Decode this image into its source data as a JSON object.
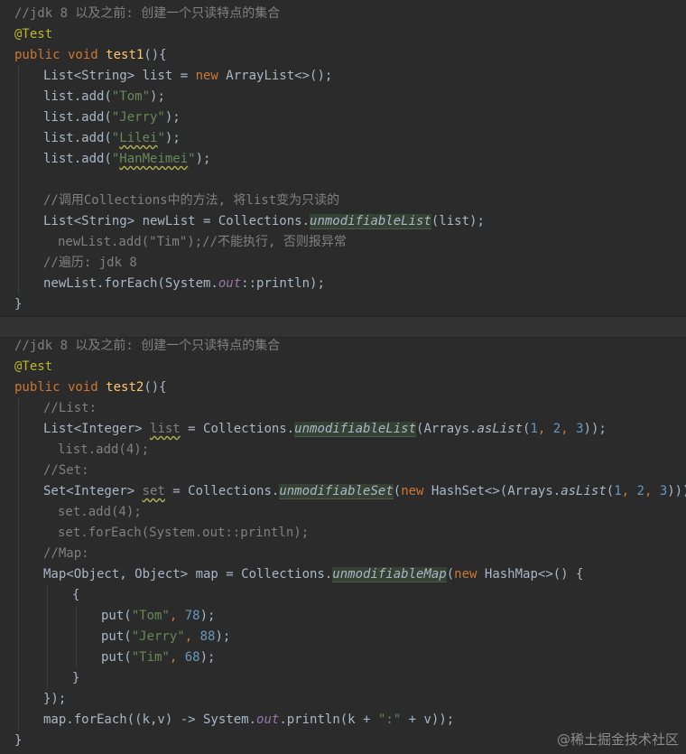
{
  "code_blocks": [
    {
      "lines": [
        {
          "indent": 0,
          "tokens": [
            {
              "t": "//jdk 8 以及之前: 创建一个只读特点的集合",
              "c": "comment"
            }
          ]
        },
        {
          "indent": 0,
          "tokens": [
            {
              "t": "@Test",
              "c": "annotation"
            }
          ]
        },
        {
          "indent": 0,
          "tokens": [
            {
              "t": "public void ",
              "c": "kw"
            },
            {
              "t": "test1",
              "c": "fn"
            },
            {
              "t": "(){",
              "c": "plain"
            }
          ]
        },
        {
          "indent": 4,
          "tokens": [
            {
              "t": "List<String> list = ",
              "c": "plain"
            },
            {
              "t": "new ",
              "c": "kw"
            },
            {
              "t": "ArrayList<>();",
              "c": "plain"
            }
          ]
        },
        {
          "indent": 4,
          "tokens": [
            {
              "t": "list.add(",
              "c": "plain"
            },
            {
              "t": "\"Tom\"",
              "c": "str"
            },
            {
              "t": ");",
              "c": "plain"
            }
          ]
        },
        {
          "indent": 4,
          "tokens": [
            {
              "t": "list.add(",
              "c": "plain"
            },
            {
              "t": "\"Jerry\"",
              "c": "str"
            },
            {
              "t": ");",
              "c": "plain"
            }
          ]
        },
        {
          "indent": 4,
          "tokens": [
            {
              "t": "list.add(",
              "c": "plain"
            },
            {
              "t": "\"",
              "c": "str"
            },
            {
              "t": "Lilei",
              "c": "str squiggle"
            },
            {
              "t": "\"",
              "c": "str"
            },
            {
              "t": ");",
              "c": "plain"
            }
          ]
        },
        {
          "indent": 4,
          "tokens": [
            {
              "t": "list.add(",
              "c": "plain"
            },
            {
              "t": "\"",
              "c": "str"
            },
            {
              "t": "HanMeimei",
              "c": "str squiggle"
            },
            {
              "t": "\"",
              "c": "str"
            },
            {
              "t": ");",
              "c": "plain"
            }
          ]
        },
        {
          "indent": 0,
          "tokens": []
        },
        {
          "indent": 4,
          "tokens": [
            {
              "t": "//调用Collections中的方法, 将list变为只读的",
              "c": "comment"
            }
          ]
        },
        {
          "indent": 4,
          "tokens": [
            {
              "t": "List<String> newList = Collections.",
              "c": "plain"
            },
            {
              "t": "unmodifiableList",
              "c": "hl"
            },
            {
              "t": "(list);",
              "c": "plain"
            }
          ]
        },
        {
          "indent": 6,
          "tokens": [
            {
              "t": "newList.add(\"Tim\");//不能执行, 否则报异常",
              "c": "comment"
            }
          ]
        },
        {
          "indent": 4,
          "tokens": [
            {
              "t": "//遍历: jdk 8",
              "c": "comment"
            }
          ]
        },
        {
          "indent": 4,
          "tokens": [
            {
              "t": "newList.forEach(System.",
              "c": "plain"
            },
            {
              "t": "out",
              "c": "field"
            },
            {
              "t": "::println);",
              "c": "plain"
            }
          ]
        },
        {
          "indent": 0,
          "tokens": [
            {
              "t": "}",
              "c": "plain"
            }
          ]
        }
      ]
    },
    {
      "lines": [
        {
          "indent": 0,
          "tokens": [
            {
              "t": "//jdk 8 以及之前: 创建一个只读特点的集合",
              "c": "comment"
            }
          ]
        },
        {
          "indent": 0,
          "tokens": [
            {
              "t": "@Test",
              "c": "annotation"
            }
          ]
        },
        {
          "indent": 0,
          "tokens": [
            {
              "t": "public void ",
              "c": "kw"
            },
            {
              "t": "test2",
              "c": "fn"
            },
            {
              "t": "(){",
              "c": "plain"
            }
          ]
        },
        {
          "indent": 4,
          "tokens": [
            {
              "t": "//List:",
              "c": "comment"
            }
          ]
        },
        {
          "indent": 4,
          "tokens": [
            {
              "t": "List<Integer> ",
              "c": "plain"
            },
            {
              "t": "list",
              "c": "comment squiggle"
            },
            {
              "t": " = Collections.",
              "c": "plain"
            },
            {
              "t": "unmodifiableList",
              "c": "hl"
            },
            {
              "t": "(Arrays.",
              "c": "plain"
            },
            {
              "t": "asList",
              "c": "static"
            },
            {
              "t": "(",
              "c": "plain"
            },
            {
              "t": "1",
              "c": "num"
            },
            {
              "t": ", ",
              "c": "kw"
            },
            {
              "t": "2",
              "c": "num"
            },
            {
              "t": ", ",
              "c": "kw"
            },
            {
              "t": "3",
              "c": "num"
            },
            {
              "t": "));",
              "c": "plain"
            }
          ]
        },
        {
          "indent": 6,
          "tokens": [
            {
              "t": "list.add(4);",
              "c": "comment"
            }
          ]
        },
        {
          "indent": 4,
          "tokens": [
            {
              "t": "//Set:",
              "c": "comment"
            }
          ]
        },
        {
          "indent": 4,
          "tokens": [
            {
              "t": "Set<Integer> ",
              "c": "plain"
            },
            {
              "t": "set",
              "c": "comment squiggle"
            },
            {
              "t": " = Collections.",
              "c": "plain"
            },
            {
              "t": "unmodifiableSet",
              "c": "hl"
            },
            {
              "t": "(",
              "c": "plain"
            },
            {
              "t": "new ",
              "c": "kw"
            },
            {
              "t": "HashSet<>(Arrays.",
              "c": "plain"
            },
            {
              "t": "asList",
              "c": "static"
            },
            {
              "t": "(",
              "c": "plain"
            },
            {
              "t": "1",
              "c": "num"
            },
            {
              "t": ", ",
              "c": "kw"
            },
            {
              "t": "2",
              "c": "num"
            },
            {
              "t": ", ",
              "c": "kw"
            },
            {
              "t": "3",
              "c": "num"
            },
            {
              "t": ")));",
              "c": "plain"
            }
          ]
        },
        {
          "indent": 6,
          "tokens": [
            {
              "t": "set.add(4);",
              "c": "comment"
            }
          ]
        },
        {
          "indent": 6,
          "tokens": [
            {
              "t": "set.forEach(System.out::println);",
              "c": "comment"
            }
          ]
        },
        {
          "indent": 4,
          "tokens": [
            {
              "t": "//Map:",
              "c": "comment"
            }
          ]
        },
        {
          "indent": 4,
          "tokens": [
            {
              "t": "Map<Object, Object> map = Collections.",
              "c": "plain"
            },
            {
              "t": "unmodifiableMap",
              "c": "hl"
            },
            {
              "t": "(",
              "c": "plain"
            },
            {
              "t": "new ",
              "c": "kw"
            },
            {
              "t": "HashMap<>() {",
              "c": "plain"
            }
          ]
        },
        {
          "indent": 8,
          "tokens": [
            {
              "t": "{",
              "c": "plain"
            }
          ]
        },
        {
          "indent": 12,
          "tokens": [
            {
              "t": "put(",
              "c": "plain"
            },
            {
              "t": "\"Tom\"",
              "c": "str"
            },
            {
              "t": ", ",
              "c": "kw"
            },
            {
              "t": "78",
              "c": "num"
            },
            {
              "t": ");",
              "c": "plain"
            }
          ]
        },
        {
          "indent": 12,
          "tokens": [
            {
              "t": "put(",
              "c": "plain"
            },
            {
              "t": "\"Jerry\"",
              "c": "str"
            },
            {
              "t": ", ",
              "c": "kw"
            },
            {
              "t": "88",
              "c": "num"
            },
            {
              "t": ");",
              "c": "plain"
            }
          ]
        },
        {
          "indent": 12,
          "tokens": [
            {
              "t": "put(",
              "c": "plain"
            },
            {
              "t": "\"Tim\"",
              "c": "str"
            },
            {
              "t": ", ",
              "c": "kw"
            },
            {
              "t": "68",
              "c": "num"
            },
            {
              "t": ");",
              "c": "plain"
            }
          ]
        },
        {
          "indent": 8,
          "tokens": [
            {
              "t": "}",
              "c": "plain"
            }
          ]
        },
        {
          "indent": 4,
          "tokens": [
            {
              "t": "});",
              "c": "plain"
            }
          ]
        },
        {
          "indent": 4,
          "tokens": [
            {
              "t": "map.forEach((k,v) -> System.",
              "c": "plain"
            },
            {
              "t": "out",
              "c": "field"
            },
            {
              "t": ".println(k + ",
              "c": "plain"
            },
            {
              "t": "\":\"",
              "c": "str"
            },
            {
              "t": " + v));",
              "c": "plain"
            }
          ]
        },
        {
          "indent": 0,
          "tokens": [
            {
              "t": "}",
              "c": "plain"
            }
          ]
        }
      ]
    }
  ],
  "watermark": "@稀土掘金技术社区",
  "theme_colors": {
    "background": "#2b2b2b",
    "keyword": "#cc7832",
    "comment": "#808080",
    "annotation": "#bbb529",
    "string": "#6a8759",
    "number": "#6897bb",
    "method_declaration": "#ffc66d",
    "static_field": "#9876aa",
    "plain": "#a9b7c6"
  }
}
